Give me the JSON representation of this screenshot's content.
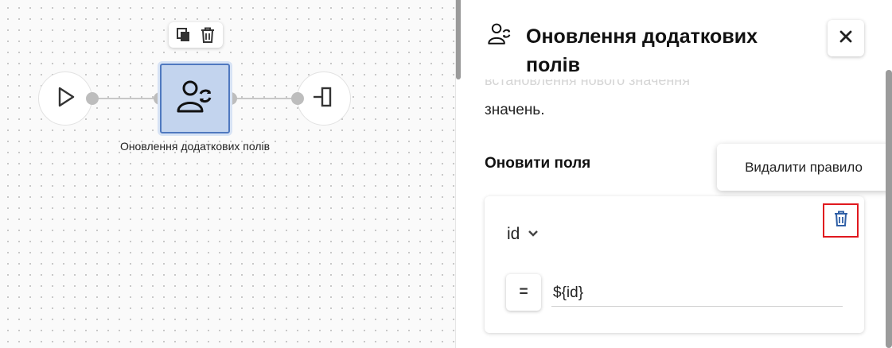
{
  "canvas": {
    "node": {
      "label": "Оновлення додаткових полів"
    },
    "toolbar": {
      "copy_icon": "copy-icon",
      "delete_icon": "trash-icon"
    },
    "start_icon": "play-icon",
    "end_icon": "end-icon"
  },
  "panel": {
    "icon": "user-sync-icon",
    "title": "Оновлення додаткових полів",
    "close_icon": "close-icon",
    "faded_text": "встановлення нового значення",
    "description_tail": "значень.",
    "section_title": "Оновити поля",
    "rule": {
      "field": "id",
      "operator": "=",
      "value": "${id}",
      "delete_icon": "trash-icon"
    }
  },
  "tooltip": {
    "text": "Видалити правило"
  },
  "colors": {
    "node_fill": "#c3d4ee",
    "node_border": "#4f78bf",
    "delete_highlight": "#e0181e",
    "delete_icon": "#2f5fa6"
  }
}
